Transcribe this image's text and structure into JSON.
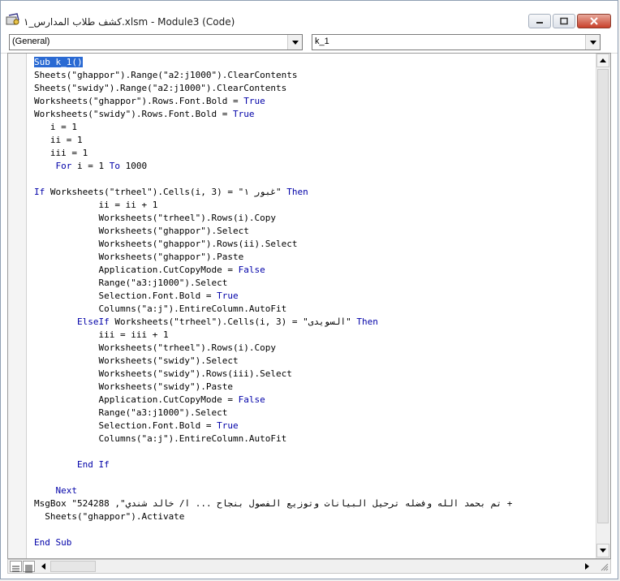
{
  "window": {
    "title": "كشف طلاب المدارس_١.xlsm - Module3 (Code)"
  },
  "combos": {
    "object": "(General)",
    "procedure": "k_1"
  },
  "code": [
    [
      {
        "t": "Sub k_1()",
        "c": "sel"
      }
    ],
    [
      {
        "t": "Sheets(\"ghappor\").Range(\"a2:j1000\").ClearContents"
      }
    ],
    [
      {
        "t": "Sheets(\"swidy\").Range(\"a2:j1000\").ClearContents"
      }
    ],
    [
      {
        "t": "Worksheets(\"ghappor\").Rows.Font.Bold = "
      },
      {
        "t": "True",
        "c": "kw"
      }
    ],
    [
      {
        "t": "Worksheets(\"swidy\").Rows.Font.Bold = "
      },
      {
        "t": "True",
        "c": "kw"
      }
    ],
    [
      {
        "t": "   i = 1"
      }
    ],
    [
      {
        "t": "   ii = 1"
      }
    ],
    [
      {
        "t": "   iii = 1"
      }
    ],
    [
      {
        "t": "    "
      },
      {
        "t": "For",
        "c": "kw"
      },
      {
        "t": " i = 1 "
      },
      {
        "t": "To",
        "c": "kw"
      },
      {
        "t": " 1000"
      }
    ],
    [
      {
        "t": ""
      }
    ],
    [
      {
        "t": "If",
        "c": "kw"
      },
      {
        "t": " Worksheets(\"trheel\").Cells(i, 3) = \"غبور ١\" "
      },
      {
        "t": "Then",
        "c": "kw"
      }
    ],
    [
      {
        "t": "            ii = ii + 1"
      }
    ],
    [
      {
        "t": "            Worksheets(\"trheel\").Rows(i).Copy"
      }
    ],
    [
      {
        "t": "            Worksheets(\"ghappor\").Select"
      }
    ],
    [
      {
        "t": "            Worksheets(\"ghappor\").Rows(ii).Select"
      }
    ],
    [
      {
        "t": "            Worksheets(\"ghappor\").Paste"
      }
    ],
    [
      {
        "t": "            Application.CutCopyMode = "
      },
      {
        "t": "False",
        "c": "kw"
      }
    ],
    [
      {
        "t": "            Range(\"a3:j1000\").Select"
      }
    ],
    [
      {
        "t": "            Selection.Font.Bold = "
      },
      {
        "t": "True",
        "c": "kw"
      }
    ],
    [
      {
        "t": "            Columns(\"a:j\").EntireColumn.AutoFit"
      }
    ],
    [
      {
        "t": "        "
      },
      {
        "t": "ElseIf",
        "c": "kw"
      },
      {
        "t": " Worksheets(\"trheel\").Cells(i, 3) = \"السويدى\" "
      },
      {
        "t": "Then",
        "c": "kw"
      }
    ],
    [
      {
        "t": "            iii = iii + 1"
      }
    ],
    [
      {
        "t": "            Worksheets(\"trheel\").Rows(i).Copy"
      }
    ],
    [
      {
        "t": "            Worksheets(\"swidy\").Select"
      }
    ],
    [
      {
        "t": "            Worksheets(\"swidy\").Rows(iii).Select"
      }
    ],
    [
      {
        "t": "            Worksheets(\"swidy\").Paste"
      }
    ],
    [
      {
        "t": "            Application.CutCopyMode = "
      },
      {
        "t": "False",
        "c": "kw"
      }
    ],
    [
      {
        "t": "            Range(\"a3:j1000\").Select"
      }
    ],
    [
      {
        "t": "            Selection.Font.Bold = "
      },
      {
        "t": "True",
        "c": "kw"
      }
    ],
    [
      {
        "t": "            Columns(\"a:j\").EntireColumn.AutoFit"
      }
    ],
    [
      {
        "t": ""
      }
    ],
    [
      {
        "t": "        "
      },
      {
        "t": "End If",
        "c": "kw"
      }
    ],
    [
      {
        "t": ""
      }
    ],
    [
      {
        "t": "    "
      },
      {
        "t": "Next",
        "c": "kw"
      }
    ],
    [
      {
        "t": "MsgBox \"تم بحمد الله وفضله ترحيل البيانات وتوزيع الفصول بنجاح ... ا/ خالد شندي\", 524288 + "
      }
    ],
    [
      {
        "t": "  Sheets(\"ghappor\").Activate"
      }
    ],
    [
      {
        "t": ""
      }
    ],
    [
      {
        "t": "End Sub",
        "c": "kw"
      }
    ]
  ],
  "colors": {
    "keyword": "#0000a8",
    "selection": "#2a6ad3",
    "close_button": "#c8402a"
  }
}
